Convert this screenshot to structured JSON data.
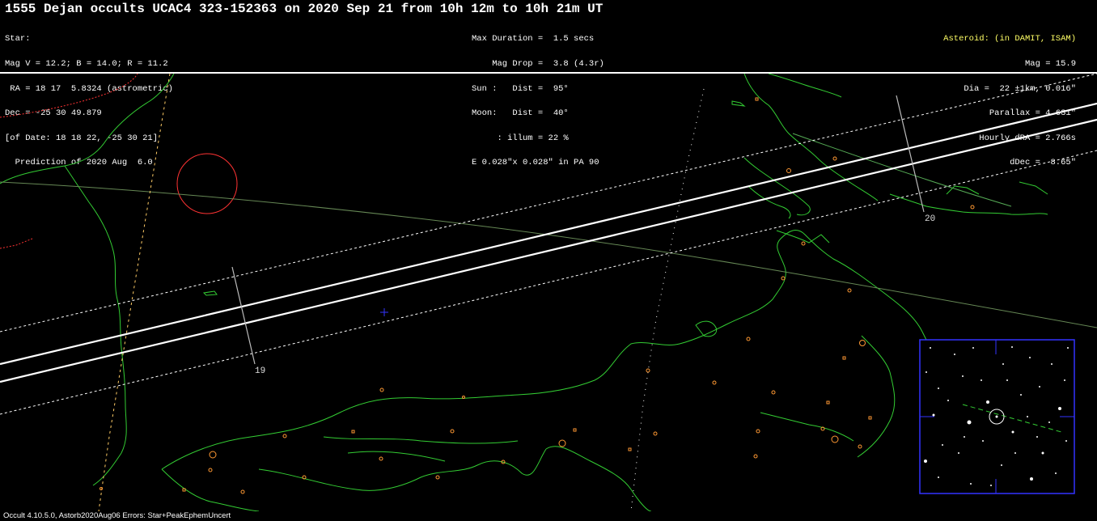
{
  "header": {
    "title": "1555 Dejan occults UCAC4 323-152363 on 2020 Sep 21 from 10h 12m to 10h 21m UT"
  },
  "star_info": {
    "lines": [
      "Star:",
      "Mag V = 12.2; B = 14.0; R = 11.2",
      " RA = 18 17  5.8324 (astrometric)",
      "Dec = -25 30 49.879",
      "[of Date: 18 18 22, -25 30 21]",
      "  Prediction of 2020 Aug  6.0"
    ]
  },
  "event_info": {
    "lines": [
      "Max Duration =  1.5 secs",
      "    Mag Drop =  3.8 (4.3r)",
      "Sun :   Dist =  95°",
      "Moon:   Dist =  40°",
      "     : illum = 22 %",
      "E 0.028\"x 0.028\" in PA 90"
    ]
  },
  "asteroid_info": {
    "heading": "Asteroid: (in DAMIT, ISAM)",
    "lines": [
      "Mag = 15.9",
      "Dia =  22 ±1km, 0.016\"",
      "Parallax = 4.631\"",
      "Hourly dRA = 2.766s",
      "dDec =  8.65\""
    ]
  },
  "map": {
    "time_ticks": [
      "19",
      "20"
    ],
    "colors": {
      "coastline": "#33cc33",
      "path_center": "#ffffff",
      "path_limits": "#ffffff",
      "sun_circle": "#ff3333",
      "city_marker": "#ff9933",
      "night_limit": "#ffcc66",
      "inset_frame": "#3333ff"
    },
    "icons": {
      "center_marker": "blue-plus-icon",
      "inset_target": "target-circle-icon"
    }
  },
  "footer": {
    "text": "Occult 4.10.5.0, Astorb2020Aug06 Errors: Star+PeakEphemUncert"
  }
}
